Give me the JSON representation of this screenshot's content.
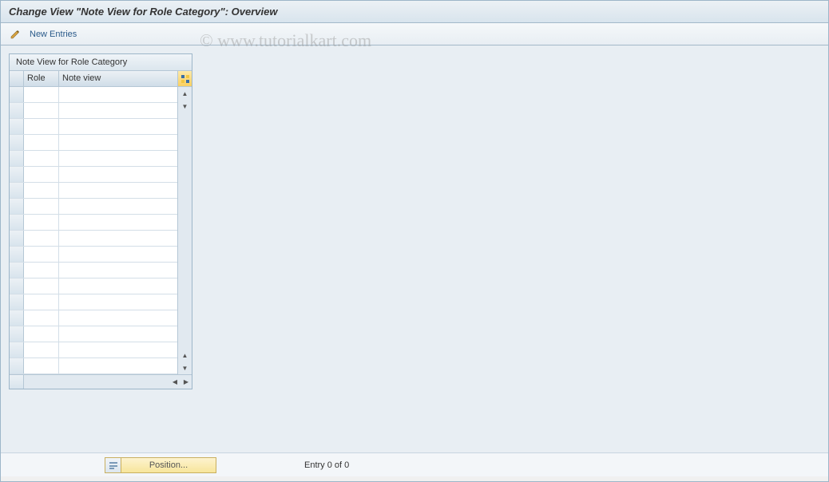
{
  "header": {
    "title": "Change View \"Note View for Role Category\": Overview"
  },
  "toolbar": {
    "new_entries_label": "New Entries"
  },
  "watermark": "© www.tutorialkart.com",
  "table": {
    "title": "Note View for Role Category",
    "columns": {
      "role": "Role",
      "note_view": "Note view"
    },
    "row_count": 18
  },
  "footer": {
    "position_label": "Position...",
    "entry_text": "Entry 0 of 0"
  }
}
